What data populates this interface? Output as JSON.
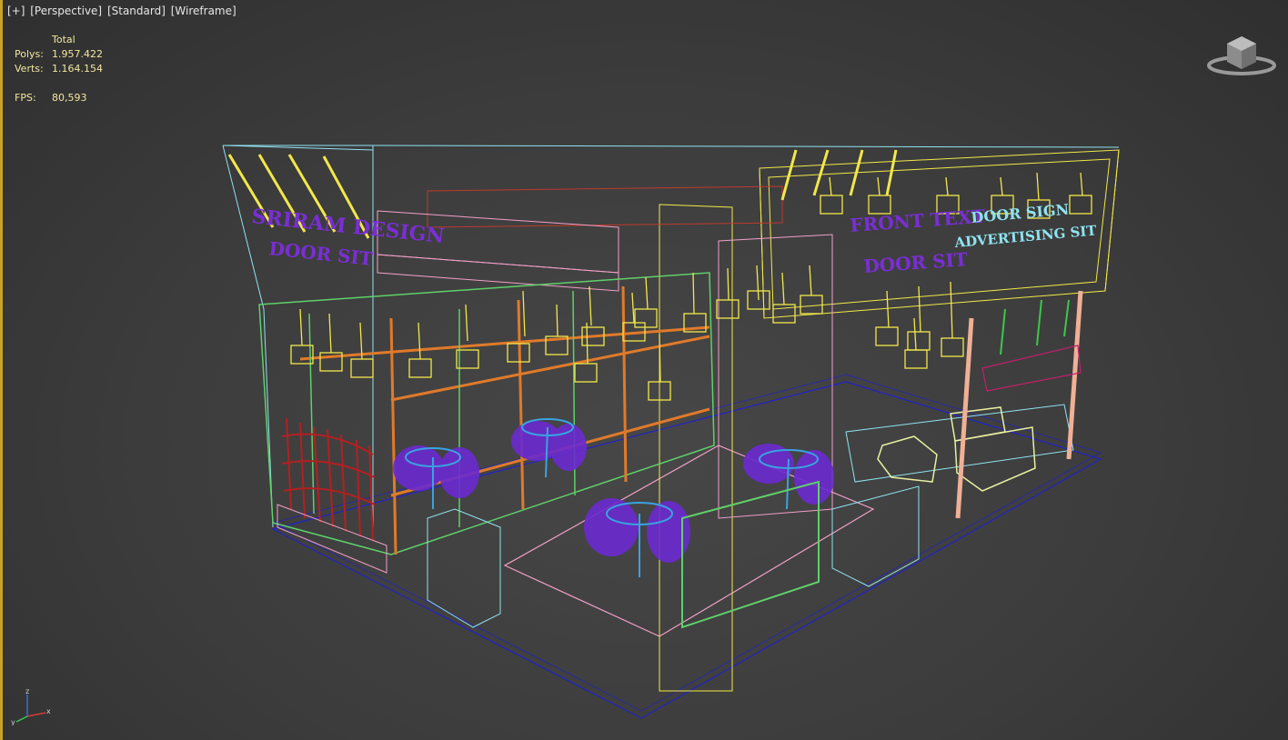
{
  "viewport": {
    "menu": [
      "[+]",
      "[Perspective]",
      "[Standard]",
      "[Wireframe]"
    ]
  },
  "stats": {
    "header": "Total",
    "polys_label": "Polys:",
    "polys_value": "1.957.422",
    "verts_label": "Verts:",
    "verts_value": "1.164.154",
    "fps_label": "FPS:",
    "fps_value": "80,593"
  },
  "scene": {
    "sign_left": [
      "SRIRAM DESIGN",
      "DOOR SIT"
    ],
    "sign_right_purple": [
      "FRONT TEXT",
      "DOOR SIT"
    ],
    "sign_right_cyan": [
      "DOOR SIGN",
      "ADVERTISING SIT"
    ],
    "colors": {
      "wire_yellow": "#f2e84a",
      "wire_green": "#5fd06a",
      "wire_cyan": "#8fe3f0",
      "wire_purple": "#7a2ed6",
      "wire_red": "#c0392b",
      "wire_pink": "#f2a0c8",
      "floor_blue": "#2222c8"
    }
  },
  "viewcube": {
    "icon": "viewcube-icon"
  },
  "axis": {
    "x_label": "x",
    "y_label": "y",
    "z_label": "z"
  }
}
